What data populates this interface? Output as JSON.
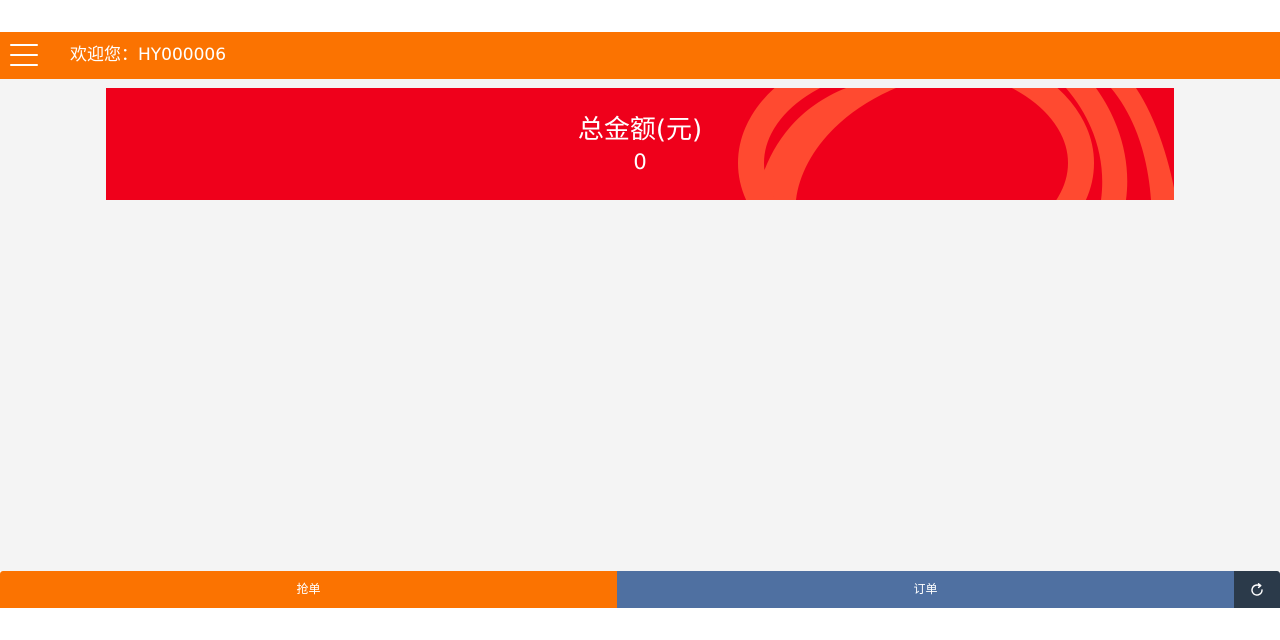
{
  "header": {
    "menu_icon": "hamburger-menu-icon",
    "welcome_text": "欢迎您：HY000006",
    "bg_color": "#fb7301"
  },
  "banner": {
    "title": "总金额(元)",
    "amount": "0",
    "bg_color": "#ef001b",
    "decor_color": "#ff4a30"
  },
  "bottom_nav": {
    "grab_order_label": "抢单",
    "orders_label": "订单",
    "refresh_icon": "refresh-icon",
    "grab_color": "#fb7301",
    "orders_color": "#4f70a1",
    "refresh_color": "#2b3a4a"
  }
}
